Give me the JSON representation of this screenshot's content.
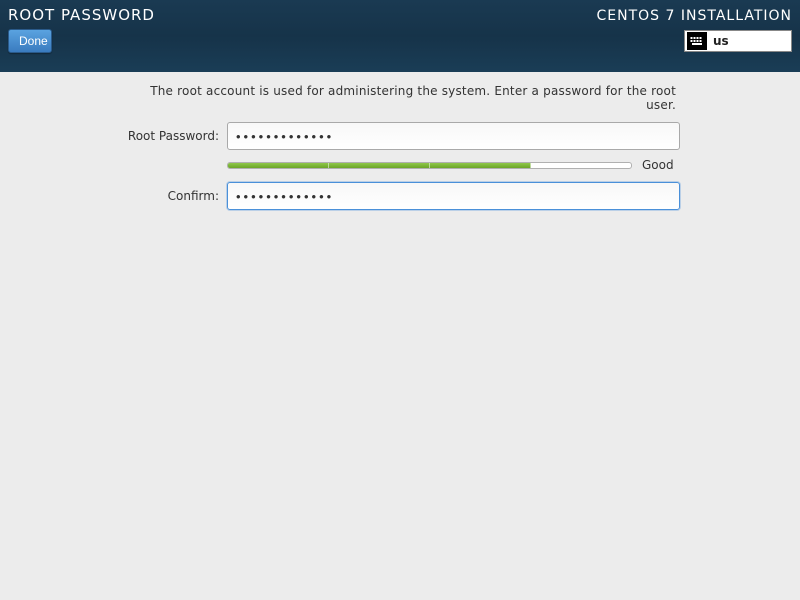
{
  "header": {
    "page_title": "ROOT PASSWORD",
    "done_label": "Done",
    "install_title": "CENTOS 7 INSTALLATION",
    "keyboard_layout": "us"
  },
  "form": {
    "description": "The root account is used for administering the system.  Enter a password for the root user.",
    "root_password_label": "Root Password:",
    "confirm_label": "Confirm:",
    "root_password_value": "•••••••••••••",
    "confirm_value": "•••••••••••••",
    "strength_text": "Good",
    "strength_segments_filled": 3,
    "strength_segments_total": 4
  }
}
